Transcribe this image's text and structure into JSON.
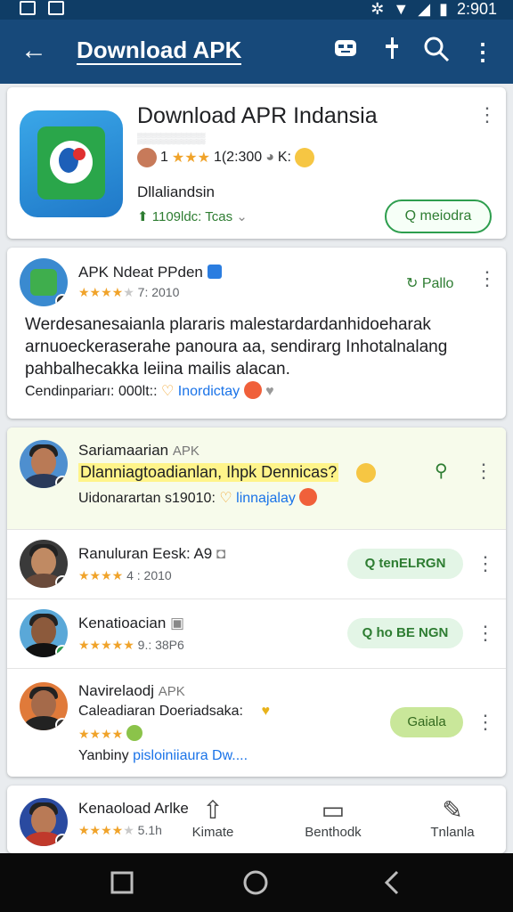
{
  "status_bar": {
    "time": "2:901"
  },
  "app_bar": {
    "title": "Download APK",
    "back_icon": "arrow-left-icon",
    "actions": [
      "robot-icon",
      "tune-icon",
      "search-icon",
      "more-vert-icon"
    ]
  },
  "hero": {
    "title": "Download APR Indansia",
    "subtitle": "▒▒▒▒▒▒▒▒▒",
    "rating_prefix": "1",
    "rating_text": "1(2:300",
    "rating_suffix": "K:",
    "developer": "Dllaliandsin",
    "installs": "1109ldc: Tcas",
    "button_label": "Q meiodra"
  },
  "featured": {
    "name": "APK Ndeat PPden",
    "meta": "7: 2010",
    "follow_label": "Pallo",
    "body": "Werdesanesaianla plararis malestardardanhidoeharak arnuoeckeraserahe panoura aa, sendirarg Inhotalnalang pahbalhecakka leiina mailis alacan.",
    "footer_prefix": "Cendinpariarı: 000lt::",
    "footer_tag": "Inordictay"
  },
  "highlight": {
    "name": "Sariamaarian",
    "name_suffix": "APK",
    "headline": "Dlanniagtoadianlan, Ihpk Dennicas?",
    "footer_prefix": "Uidonarartan s19010:",
    "footer_tag": "linnajalay"
  },
  "rows": [
    {
      "name": "Ranuluran Eesk: A9",
      "meta": "4 : 2010",
      "button": "Q tenELRGN",
      "avatar_bg": "#3a3a3a",
      "face": "#c08a63"
    },
    {
      "name": "Kenatioacian",
      "meta": "9.: 38P6",
      "button": "Q ho BE NGN",
      "avatar_bg": "#5aa8d8",
      "face": "#8c5a3c"
    },
    {
      "name": "Navirelaodj",
      "name_suffix": "APK",
      "line2": "Caleadiaran Doeriadsaka:",
      "button": "Gaiala",
      "tag_prefix": "Yanbiny",
      "tag_text": "pisloiniiaura Dw....",
      "avatar_bg": "#e07a3a",
      "face": "#a56a4a"
    }
  ],
  "last_row": {
    "name": "Kenaoload Arlke",
    "meta": "5.1h"
  },
  "bottom_nav": [
    {
      "label": "Kimate",
      "icon": "upload-icon"
    },
    {
      "label": "Benthodk",
      "icon": "chat-icon"
    },
    {
      "label": "Tnlanla",
      "icon": "edit-icon"
    }
  ],
  "colors": {
    "app_bar": "#17497a",
    "status_bar": "#0f3d66",
    "accent_green": "#2e7d32",
    "highlight_bg": "#f7fbeb"
  }
}
